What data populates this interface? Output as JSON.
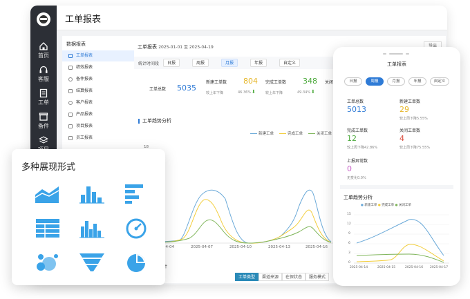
{
  "app": {
    "title": "工单报表"
  },
  "sidebar": {
    "items": [
      {
        "label": "首页",
        "icon": "home-icon"
      },
      {
        "label": "客服",
        "icon": "headset-icon"
      },
      {
        "label": "工单",
        "icon": "ticket-icon"
      },
      {
        "label": "备件",
        "icon": "box-icon"
      },
      {
        "label": "项目",
        "icon": "layers-icon"
      }
    ]
  },
  "menu": {
    "header": "数据报表",
    "items": [
      {
        "label": "工单报表",
        "active": true
      },
      {
        "label": "绩效报表"
      },
      {
        "label": "备件报表"
      },
      {
        "label": "结算报表"
      },
      {
        "label": "客户报表"
      },
      {
        "label": "产品报表"
      },
      {
        "label": "项目报表"
      },
      {
        "label": "员工报表"
      }
    ]
  },
  "report": {
    "title": "工单报表",
    "date_range": "2025-01-01 至 2025-04-19",
    "export_label": "导出",
    "period_label": "统计时间段",
    "periods": [
      "日报",
      "周报",
      "月报",
      "年报",
      "自定义"
    ],
    "active_period": "月报"
  },
  "stats": {
    "total_label": "工单总数",
    "total_value": "5035",
    "new_label": "新建工单数",
    "new_value": "804",
    "new_sub": "较上年下降",
    "new_pct": "46.36%",
    "done_label": "完成工单数",
    "done_value": "348",
    "done_sub": "较上年下降",
    "done_pct": "49.34%",
    "closed_label": "关闭"
  },
  "trend": {
    "title": "工单趋势分析",
    "legend": [
      "新建工单",
      "完成工单",
      "关闭工单"
    ],
    "y_label": "18",
    "x_labels": [
      "2025-04-04",
      "2025-04-07",
      "2025-04-10",
      "2025-04-13",
      "2025-04-16"
    ]
  },
  "bottom": {
    "tabs": [
      "工单类型",
      "渠道来源",
      "在保状态",
      "服务模式"
    ],
    "stat_title": "计"
  },
  "card": {
    "title": "多种展现形式",
    "icons": [
      "area-chart-icon",
      "bar-chart-icon",
      "horizontal-bar-icon",
      "table-icon",
      "column-chart-icon",
      "gauge-icon",
      "bubble-chart-icon",
      "funnel-icon",
      "pie-chart-icon"
    ]
  },
  "phone": {
    "title": "工单报表",
    "tabs": [
      "日报",
      "周报",
      "月报",
      "年报",
      "自定义"
    ],
    "active_tab": "周报",
    "stats": {
      "total_label": "工单总数",
      "total_value": "5013",
      "new_label": "新建工单数",
      "new_value": "29",
      "new_sub": "较上周下降5.55%",
      "done_label": "完成工单数",
      "done_value": "12",
      "done_sub": "较上周下降42.86%",
      "closed_label": "关闭工单数",
      "closed_value": "4",
      "closed_sub": "较上周下降75.55%",
      "report_label": "上报异常数",
      "report_value": "0",
      "report_sub": "无变化0.0%"
    },
    "chart": {
      "title": "工单趋势分析",
      "legend": [
        "新建工单",
        "完成工单",
        "关闭工单"
      ],
      "y_ticks": [
        "15",
        "12",
        "9",
        "6",
        "3",
        "0"
      ],
      "x_labels": [
        "2025-04-14",
        "2025-04-15",
        "2025-04-16",
        "2025-04-17"
      ]
    }
  },
  "colors": {
    "blue": "#6aa9d8",
    "yellow": "#f2cd3a",
    "green": "#7fb55a",
    "accent": "#2f7bd6",
    "icon": "#3aa3e8"
  }
}
